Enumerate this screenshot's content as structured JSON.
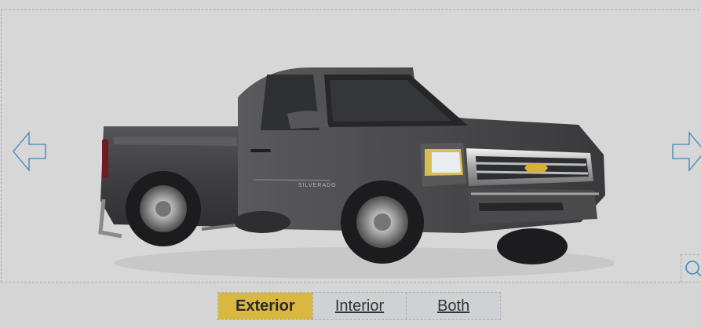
{
  "viewer": {
    "tabs": [
      {
        "label": "Exterior",
        "active": true
      },
      {
        "label": "Interior",
        "active": false
      },
      {
        "label": "Both",
        "active": false
      }
    ],
    "icons": {
      "prev": "left-arrow-icon",
      "next": "right-arrow-icon",
      "zoom": "search-icon"
    },
    "colors": {
      "background": "#d5d5d5",
      "active_tab": "#d9b842",
      "inactive_tab": "#cfd1d5",
      "border": "#a8aeb6",
      "icon_stroke": "#3b86bd",
      "truck_body": "#424244"
    }
  }
}
